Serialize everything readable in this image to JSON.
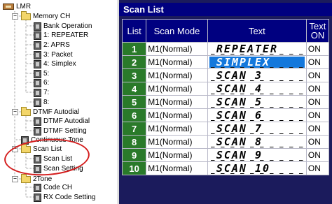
{
  "tree": {
    "root": {
      "label": "LMR"
    },
    "memory_ch": {
      "label": "Memory CH",
      "children": [
        "Bank Operation",
        "1: REPEATER",
        "2: APRS",
        "3: Packet",
        "4: Simplex",
        "5:",
        "6:",
        "7:",
        "8:"
      ]
    },
    "dtmf_autodial": {
      "label": "DTMF Autodial",
      "children": [
        "DTMF Autodial",
        "DTMF Setting"
      ]
    },
    "continuous_tone": {
      "label": "Continuous Tone"
    },
    "scan_list": {
      "label": "Scan List",
      "children": [
        "Scan List",
        "Scan Setting"
      ]
    },
    "two_tone": {
      "label": "2Tone",
      "children": [
        "Code CH",
        "RX Code Setting"
      ]
    }
  },
  "panel": {
    "title": "Scan List",
    "columns": {
      "list": "List",
      "mode": "Scan Mode",
      "text": "Text",
      "text_on_1": "Text",
      "text_on_2": "ON"
    },
    "rows": [
      {
        "num": "1",
        "mode": "M1(Normal)",
        "text": "REPEATER",
        "on": "ON"
      },
      {
        "num": "2",
        "mode": "M1(Normal)",
        "text": "SIMPLEX",
        "on": "ON"
      },
      {
        "num": "3",
        "mode": "M1(Normal)",
        "text": "SCAN 3",
        "on": "ON"
      },
      {
        "num": "4",
        "mode": "M1(Normal)",
        "text": "SCAN 4",
        "on": "ON"
      },
      {
        "num": "5",
        "mode": "M1(Normal)",
        "text": "SCAN 5",
        "on": "ON"
      },
      {
        "num": "6",
        "mode": "M1(Normal)",
        "text": "SCAN 6",
        "on": "ON"
      },
      {
        "num": "7",
        "mode": "M1(Normal)",
        "text": "SCAN 7",
        "on": "ON"
      },
      {
        "num": "8",
        "mode": "M1(Normal)",
        "text": "SCAN 8",
        "on": "ON"
      },
      {
        "num": "9",
        "mode": "M1(Normal)",
        "text": "SCAN 9",
        "on": "ON"
      },
      {
        "num": "10",
        "mode": "M1(Normal)",
        "text": "SCAN 10",
        "on": "ON"
      }
    ],
    "selected_row": 2
  },
  "colors": {
    "header_bg": "#000080",
    "row_number_bg": "#2a7a2a",
    "selection": "#1478dc",
    "annotation_ring": "#d41e1e"
  }
}
